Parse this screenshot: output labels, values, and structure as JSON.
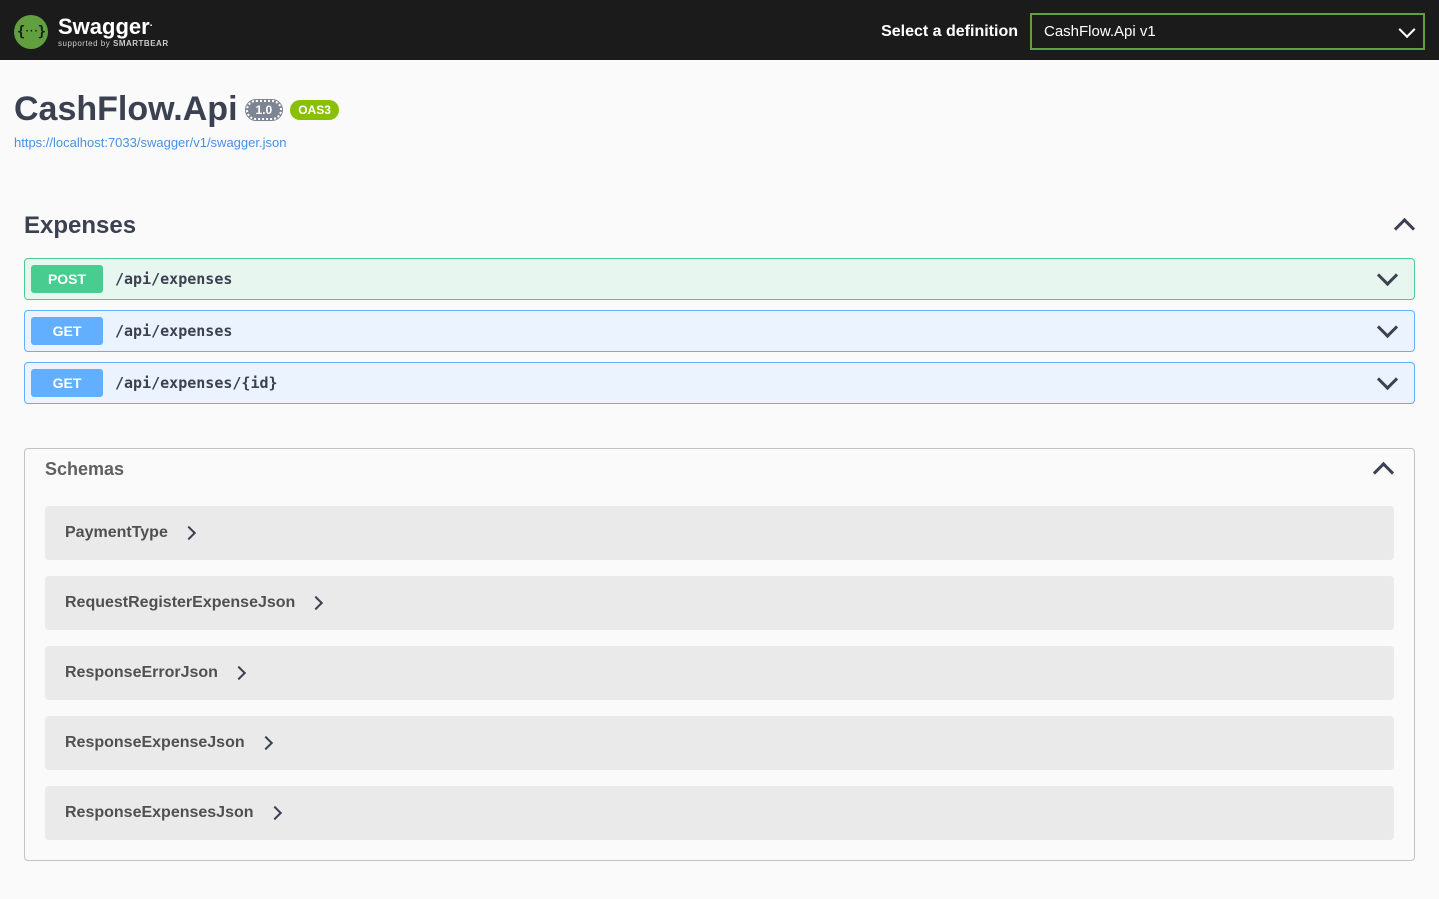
{
  "topbar": {
    "brand": "Swagger",
    "supported_prefix": "supported by ",
    "supported_brand": "SMARTBEAR",
    "select_label": "Select a definition",
    "definition_selected": "CashFlow.Api v1"
  },
  "info": {
    "title": "CashFlow.Api",
    "version": "1.0",
    "oas": "OAS3",
    "spec_url": "https://localhost:7033/swagger/v1/swagger.json"
  },
  "tag": {
    "name": "Expenses"
  },
  "operations": [
    {
      "method": "POST",
      "path": "/api/expenses",
      "method_class": "post"
    },
    {
      "method": "GET",
      "path": "/api/expenses",
      "method_class": "get"
    },
    {
      "method": "GET",
      "path": "/api/expenses/{id}",
      "method_class": "get"
    }
  ],
  "schemas": {
    "title": "Schemas",
    "items": [
      {
        "name": "PaymentType"
      },
      {
        "name": "RequestRegisterExpenseJson"
      },
      {
        "name": "ResponseErrorJson"
      },
      {
        "name": "ResponseExpenseJson"
      },
      {
        "name": "ResponseExpensesJson"
      }
    ]
  }
}
